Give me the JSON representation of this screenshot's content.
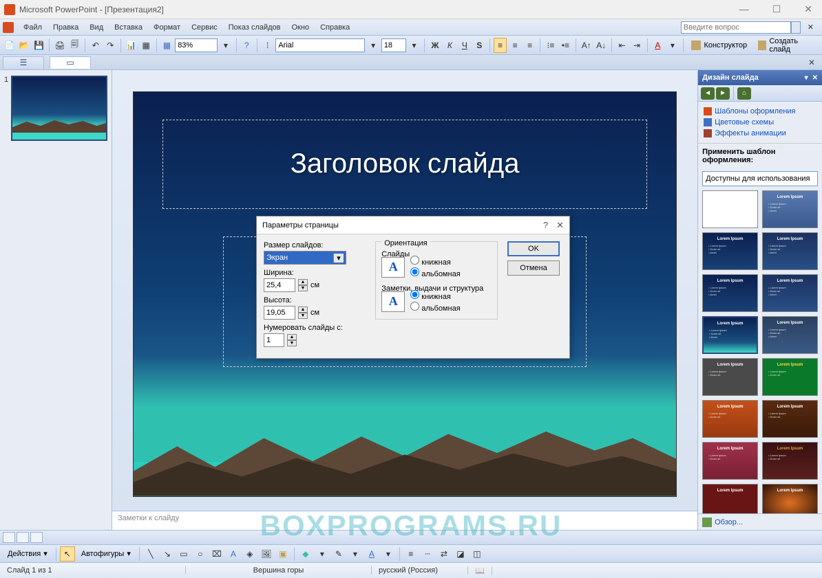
{
  "title": "Microsoft PowerPoint - [Презентация2]",
  "menu": {
    "file": "Файл",
    "edit": "Правка",
    "view": "Вид",
    "insert": "Вставка",
    "format": "Формат",
    "tools": "Сервис",
    "slideshow": "Показ слайдов",
    "window": "Окно",
    "help": "Справка",
    "help_placeholder": "Введите вопрос"
  },
  "toolbar": {
    "zoom": "83%",
    "font": "Arial",
    "size": "18",
    "designer": "Конструктор",
    "new_slide": "Создать слайд"
  },
  "thumbs": {
    "num1": "1"
  },
  "slide": {
    "title": "Заголовок слайда"
  },
  "notes": "Заметки к слайду",
  "taskpane": {
    "title": "Дизайн слайда",
    "lnk_templates": "Шаблоны оформления",
    "lnk_colors": "Цветовые схемы",
    "lnk_effects": "Эффекты анимации",
    "apply": "Применить шаблон оформления:",
    "available": "Доступны для использования",
    "browse": "Обзор..."
  },
  "draw": {
    "actions": "Действия",
    "autoshapes": "Автофигуры"
  },
  "status": {
    "slide": "Слайд 1 из 1",
    "theme": "Вершина горы",
    "lang": "русский (Россия)"
  },
  "dialog": {
    "title": "Параметры страницы",
    "slide_size": "Размер слайдов:",
    "size_value": "Экран",
    "width": "Ширина:",
    "width_val": "25,4",
    "height": "Высота:",
    "height_val": "19,05",
    "unit": "см",
    "number_from": "Нумеровать слайды с:",
    "number_val": "1",
    "orientation": "Ориентация",
    "slides_grp": "Слайды",
    "notes_grp": "Заметки, выдачи и структура",
    "portrait": "книжная",
    "landscape": "альбомная",
    "ok": "OK",
    "cancel": "Отмена"
  },
  "watermark": "BOXPROGRAMS.RU"
}
